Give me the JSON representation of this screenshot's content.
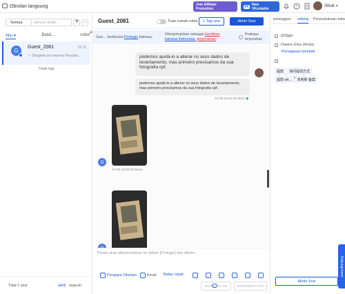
{
  "app": {
    "title": "Obrolan langsung"
  },
  "top": {
    "affiliate_label": "Join Affiliate Promotion",
    "vk_label": "New VKontakte",
    "vk_badge": "VK",
    "user_name": "Sibuk"
  },
  "left": {
    "filter_value": "Semua",
    "search_placeholder": "mencari detail...",
    "tabs": [
      "Aku",
      "Batal...",
      "robot"
    ],
    "robot_badge": "4",
    "conversation": {
      "avatar_letter": "G",
      "name": "Guest_2081",
      "time": "22:11",
      "preview": "✓ Obrigado por esperar Prezado..."
    },
    "no_more": "Tidak lagi",
    "total": "Total 1 sesi",
    "active_label": "aktif",
    "history_label": "sejarah"
  },
  "center": {
    "guest_name": "Guest_2081",
    "robot_toggle_label": "Tuan rumah robot",
    "tag_button": "+ Tag sesi",
    "end_button": "Akhiri Sesi",
    "trans_prefix": "Gue... berbicara",
    "trans_lang_src": "Portugis",
    "trans_mid": "bahasa,",
    "trans_b1": "Diterjemahkan sebagai",
    "trans_b2": "Hentikan",
    "trans_b3": "bahasa Indonesia,",
    "trans_b4": "terjemahan",
    "pretrans": "Pratinjau terjemahan",
    "msg1_original": "podemos ajudá-lo a alterar os seus dados de levantamento, mas primeiro precisamos da sua fotografia cpf.",
    "msg1_translated": "podemos ajudá-lo a alterar os seus dados de levantamento, mas primeiro precisamos da sua fotografia cpf.",
    "msg1_time": "10-05 22:51:24",
    "msg1_status": "kirim",
    "img1_time": "10-05 23:03:25",
    "img1_status": "baca",
    "img2_time": "10-05 23:03:25",
    "img2_status": "baca",
    "guest_avatar": "G",
    "composer_placeholder": "Pesan akan diterjemahkan ke dalam [Portugis] dan dikirim",
    "tool_service": "Pengaya Obrolan",
    "tool_email": "Email",
    "tool_quick": "Balas cepat",
    "btn_send_now": "kirim balas asli",
    "btn_translate_send": "terjemahkan kirim"
  },
  "right": {
    "tabs": [
      "pelanggan",
      "sidang",
      "Perpustakaan kata"
    ],
    "id_label": "j2t3ggv",
    "agent_name": "Daiane Eloa",
    "agent_self": "(Anda)",
    "transfer_link": "Penugasan kembali",
    "tag_button": "+ tag sesi",
    "qa": [
      [
        "提款",
        "询问提现方式"
      ],
      [
        "提款 wit...",
        "未到账 备案"
      ]
    ],
    "end_button": "Akhiri Sesi",
    "contact": "Hubungi kami"
  },
  "colors": {
    "primary": "#1a56db",
    "avatar": "#4a7be8",
    "affiliate": "#6d5bd0",
    "vk": "#2c66d9"
  }
}
